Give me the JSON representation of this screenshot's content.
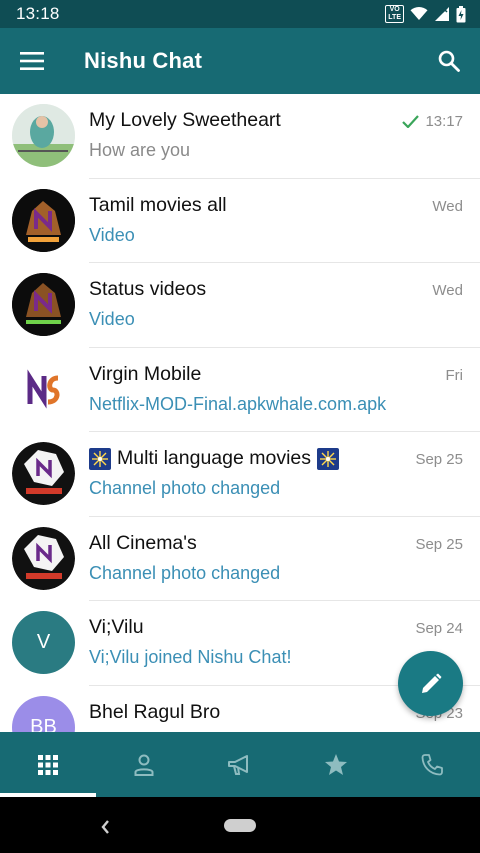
{
  "status_bar": {
    "time": "13:18",
    "volte_top": "VO",
    "volte_bottom": "LTE"
  },
  "app_bar": {
    "title": "Nishu Chat",
    "menu_icon": "menu-icon",
    "search_icon": "search-icon"
  },
  "chats": [
    {
      "name": "My Lovely Sweetheart",
      "time": "13:17",
      "subtitle": "How are you",
      "sent_check": true
    },
    {
      "name": "Tamil movies all",
      "time": "Wed",
      "subtitle": "Video"
    },
    {
      "name": "Status videos",
      "time": "Wed",
      "subtitle": "Video"
    },
    {
      "name": "Virgin Mobile",
      "time": "Fri",
      "subtitle": "Netflix-MOD-Final.apkwhale.com.apk"
    },
    {
      "name": "Multi language movies",
      "time": "Sep 25",
      "subtitle": "Channel photo changed"
    },
    {
      "name": "All Cinema's",
      "time": "Sep 25",
      "subtitle": "Channel photo changed"
    },
    {
      "name": "Vi;Vilu",
      "time": "Sep 24",
      "subtitle": "Vi;Vilu joined Nishu Chat!",
      "avatar_letter": "V"
    },
    {
      "name": "Bhel Ragul Bro",
      "time": "Sep 23",
      "subtitle": "",
      "avatar_letter": "BB"
    }
  ],
  "bottom_nav": [
    {
      "icon": "grid-icon",
      "active": true
    },
    {
      "icon": "person-icon",
      "active": false
    },
    {
      "icon": "megaphone-icon",
      "active": false
    },
    {
      "icon": "star-icon",
      "active": false
    },
    {
      "icon": "phone-icon",
      "active": false
    }
  ],
  "colors": {
    "status_bar": "#0f4d54",
    "app_bar": "#176a73",
    "fab": "#1a7a84",
    "link_text": "#3b8fb5",
    "avatar_v": "#2a7b82",
    "avatar_bb": "#9b8de8"
  }
}
